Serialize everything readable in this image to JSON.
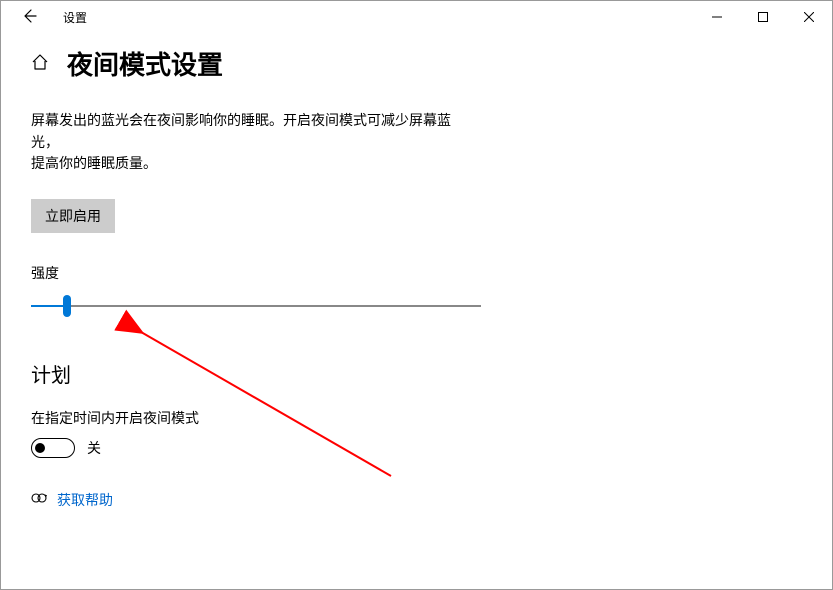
{
  "window": {
    "title": "设置"
  },
  "page": {
    "title": "夜间模式设置",
    "description_line1": "屏幕发出的蓝光会在夜间影响你的睡眠。开启夜间模式可减少屏幕蓝光，",
    "description_line2": "提高你的睡眠质量。"
  },
  "actions": {
    "enable_now": "立即启用"
  },
  "slider": {
    "label": "强度",
    "value_pct": 8
  },
  "schedule": {
    "section_title": "计划",
    "toggle_label": "在指定时间内开启夜间模式",
    "toggle_state": "关",
    "toggle_on": false
  },
  "help": {
    "label": "获取帮助"
  },
  "colors": {
    "accent": "#0078d7",
    "link": "#0066cc"
  }
}
